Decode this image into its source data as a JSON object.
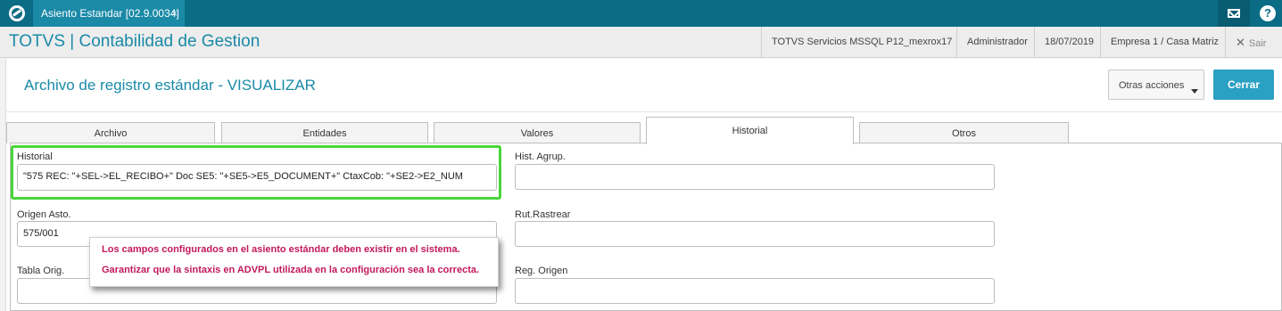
{
  "topbar": {
    "tab_label": "Asiento Estandar [02.9.0034]",
    "tab_close": "×",
    "help": "?"
  },
  "header": {
    "app_title": "TOTVS | Contabilidad de Gestion",
    "environment": "TOTVS Servicios MSSQL P12_mexrox17",
    "user": "Administrador",
    "date": "18/07/2019",
    "company": "Empresa 1 / Casa Matriz",
    "exit_label": "Sair"
  },
  "page": {
    "title": "Archivo de registro estándar - VISUALIZAR",
    "other_actions": "Otras acciones",
    "close": "Cerrar"
  },
  "tabs": [
    {
      "label": "Archivo"
    },
    {
      "label": "Entidades"
    },
    {
      "label": "Valores"
    },
    {
      "label": "Historial"
    },
    {
      "label": "Otros"
    }
  ],
  "fields": {
    "historial": {
      "label": "Historial",
      "value": "\"575 REC: \"+SEL->EL_RECIBO+\" Doc SE5: \"+SE5->E5_DOCUMENT+\" CtaxCob: \"+SE2->E2_NUM"
    },
    "origen_asto": {
      "label": "Origen Asto.",
      "value": "575/001"
    },
    "tabla_orig": {
      "label": "Tabla Orig.",
      "value": ""
    },
    "hist_agrup": {
      "label": "Hist. Agrup.",
      "value": ""
    },
    "rut_rastrear": {
      "label": "Rut.Rastrear",
      "value": ""
    },
    "reg_origen": {
      "label": "Reg. Origen",
      "value": ""
    }
  },
  "note": {
    "line1": "Los campos configurados en el asiento estándar deben existir en el sistema.",
    "line2": "Garantizar que la sintaxis en ADVPL utilizada en la configuración sea la correcta."
  },
  "colors": {
    "topbar": "#0a6c85",
    "accent": "#1a8aa7",
    "primary_button": "#2aa0c2",
    "highlight": "#49d63a",
    "note_text": "#c2185b"
  }
}
